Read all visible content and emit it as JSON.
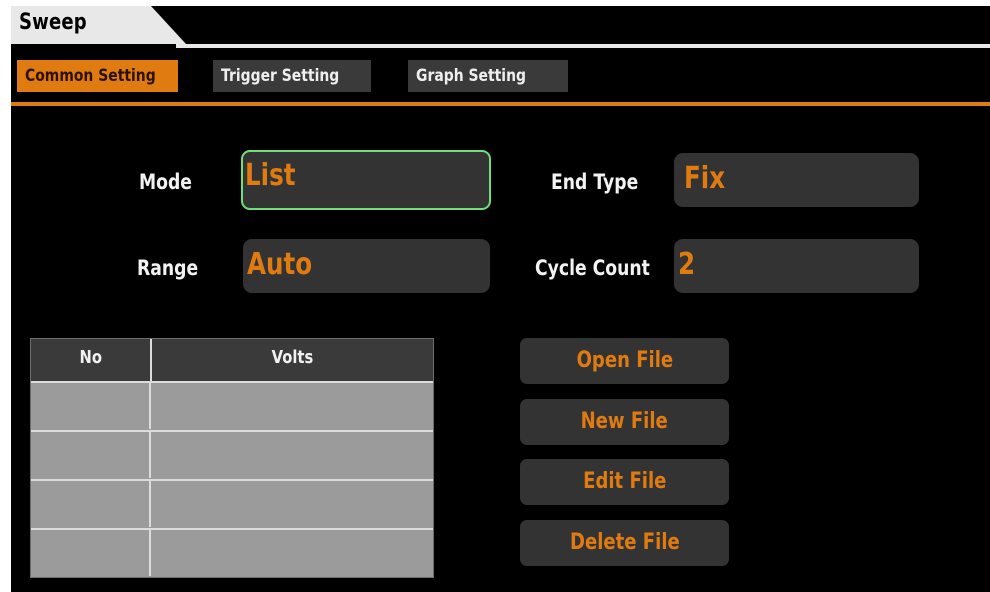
{
  "window": {
    "title": "Sweep"
  },
  "tabs": [
    {
      "label": "Common Setting",
      "active": true
    },
    {
      "label": "Trigger Setting",
      "active": false
    },
    {
      "label": "Graph Setting",
      "active": false
    }
  ],
  "form": {
    "mode": {
      "label": "Mode",
      "value": "List"
    },
    "range": {
      "label": "Range",
      "value": "Auto"
    },
    "end_type": {
      "label": "End Type",
      "value": "Fix"
    },
    "cycle_count": {
      "label": "Cycle Count",
      "value": "2"
    }
  },
  "list_table": {
    "columns": [
      "No",
      "Volts"
    ],
    "rows": [
      [
        "",
        ""
      ],
      [
        "",
        ""
      ],
      [
        "",
        ""
      ],
      [
        "",
        ""
      ]
    ]
  },
  "file_buttons": {
    "open": "Open File",
    "new": "New File",
    "edit": "Edit File",
    "delete": "Delete File"
  },
  "colors": {
    "accent": "#e07b12",
    "background": "#000000",
    "field_background": "#333333",
    "focus_border": "#6ee07a",
    "table_body": "#9b9b9b"
  }
}
